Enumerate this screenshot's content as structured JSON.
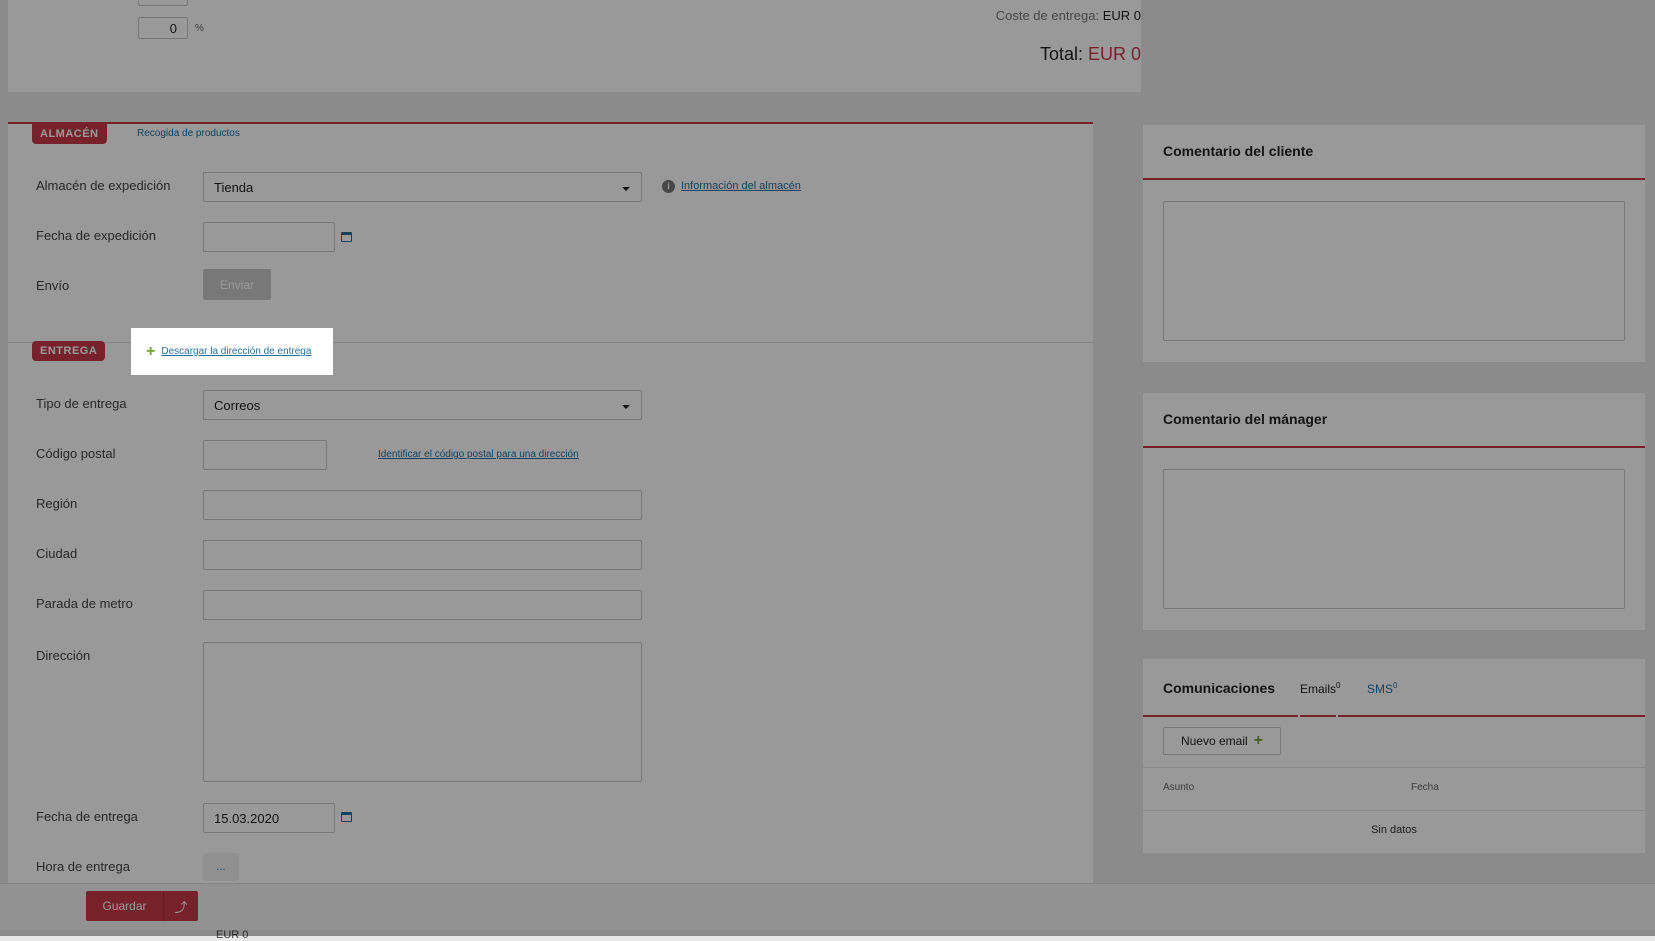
{
  "top": {
    "discount_value": "0",
    "percent_sign": "%",
    "shipping_cost_label": "Coste de entrega:",
    "shipping_cost_value": "EUR 0",
    "total_label": "Total:",
    "total_value": "EUR 0"
  },
  "warehouse": {
    "tag": "ALMACÉN",
    "tab_link": "Recogida de productos",
    "warehouse_label": "Almacén de expedición",
    "warehouse_value": "Tienda",
    "warehouse_info_link": "Información del almacén",
    "dispatch_date_label": "Fecha de expedición",
    "dispatch_date_value": "",
    "shipment_label": "Envío",
    "send_button": "Enviar"
  },
  "delivery": {
    "tag": "ENTREGA",
    "download_address_link": "Descargar la dirección de entrega",
    "type_label": "Tipo de entrega",
    "type_value": "Correos",
    "postal_code_label": "Código postal",
    "postal_code_value": "",
    "identify_postal_link": "Identificar el código postal para una dirección",
    "region_label": "Región",
    "city_label": "Ciudad",
    "metro_label": "Parada de metro",
    "address_label": "Dirección",
    "date_label": "Fecha de entrega",
    "date_value": "15.03.2020",
    "time_label": "Hora de entrega",
    "time_value": "..."
  },
  "client_comment": {
    "title": "Comentario del cliente"
  },
  "manager_comment": {
    "title": "Comentario del mánager"
  },
  "communications": {
    "title": "Comunicaciones",
    "tab_emails": "Emails",
    "tab_emails_count": "0",
    "tab_sms": "SMS",
    "tab_sms_count": "0",
    "new_email_button": "Nuevo email",
    "col_subject": "Asunto",
    "col_date": "Fecha",
    "empty_text": "Sin datos"
  },
  "footer": {
    "save_button": "Guardar",
    "partial_label": "EUR 0"
  },
  "colors": {
    "accent": "#c73a48",
    "link": "#1f6f9f",
    "plus": "#6fa32a"
  }
}
